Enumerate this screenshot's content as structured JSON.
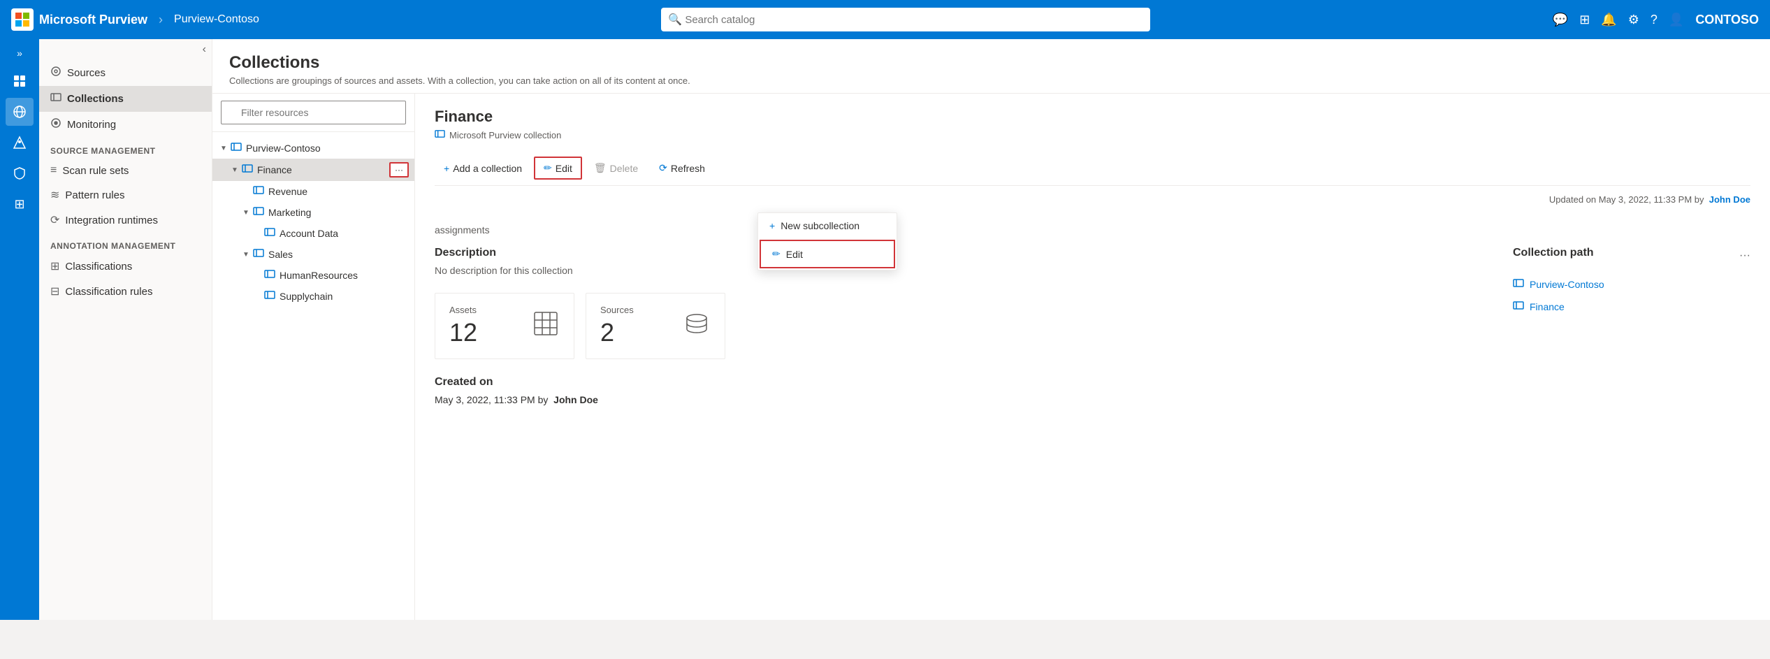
{
  "app": {
    "brand": "Microsoft Purview",
    "tenant": "Purview-Contoso",
    "search_placeholder": "Search catalog",
    "user": "CONTOSO"
  },
  "top_nav_icons": [
    {
      "name": "chat-icon",
      "symbol": "💬"
    },
    {
      "name": "grid-icon",
      "symbol": "⊞"
    },
    {
      "name": "bell-icon",
      "symbol": "🔔"
    },
    {
      "name": "settings-icon",
      "symbol": "⚙"
    },
    {
      "name": "help-icon",
      "symbol": "?"
    },
    {
      "name": "person-icon",
      "symbol": "👤"
    }
  ],
  "sidebar_icons": [
    {
      "name": "expand-icon",
      "symbol": "»"
    },
    {
      "name": "data-catalog-icon",
      "symbol": "🗂"
    },
    {
      "name": "data-map-icon",
      "symbol": "🗺"
    },
    {
      "name": "insights-icon",
      "symbol": "📊"
    },
    {
      "name": "policy-icon",
      "symbol": "🛡"
    },
    {
      "name": "solutions-icon",
      "symbol": "⊞"
    }
  ],
  "left_nav": {
    "collapse_label": "‹",
    "items": [
      {
        "id": "sources",
        "label": "Sources",
        "icon": "⊙"
      },
      {
        "id": "collections",
        "label": "Collections",
        "icon": "⊡",
        "active": true
      },
      {
        "id": "monitoring",
        "label": "Monitoring",
        "icon": "◎"
      }
    ],
    "source_management": {
      "label": "Source management",
      "items": [
        {
          "id": "scan-rule-sets",
          "label": "Scan rule sets",
          "icon": "≡"
        },
        {
          "id": "pattern-rules",
          "label": "Pattern rules",
          "icon": "≋"
        },
        {
          "id": "integration-runtimes",
          "label": "Integration runtimes",
          "icon": "⟳"
        }
      ]
    },
    "annotation_management": {
      "label": "Annotation management",
      "items": [
        {
          "id": "classifications",
          "label": "Classifications",
          "icon": "⊞"
        },
        {
          "id": "classification-rules",
          "label": "Classification rules",
          "icon": "⊟"
        }
      ]
    }
  },
  "page": {
    "title": "Collections",
    "description": "Collections are groupings of sources and assets. With a collection, you can take action on all of its content at once."
  },
  "filter": {
    "placeholder": "Filter resources"
  },
  "tree": {
    "root": "Purview-Contoso",
    "nodes": [
      {
        "id": "finance",
        "label": "Finance",
        "indent": 1,
        "selected": true,
        "show_more": true,
        "children": [
          {
            "id": "revenue",
            "label": "Revenue",
            "indent": 2
          },
          {
            "id": "marketing",
            "label": "Marketing",
            "indent": 2,
            "children": [
              {
                "id": "account-data",
                "label": "Account Data",
                "indent": 3
              }
            ]
          },
          {
            "id": "sales",
            "label": "Sales",
            "indent": 2,
            "children": [
              {
                "id": "human-resources",
                "label": "HumanResources",
                "indent": 3
              },
              {
                "id": "supplychain",
                "label": "Supplychain",
                "indent": 3
              }
            ]
          }
        ]
      }
    ]
  },
  "dropdown": {
    "items": [
      {
        "id": "new-subcollection",
        "label": "New subcollection",
        "icon": "+"
      },
      {
        "id": "edit",
        "label": "Edit",
        "icon": "✏",
        "highlighted": true
      }
    ]
  },
  "detail": {
    "title": "Finance",
    "subtitle": "Microsoft Purview collection",
    "subtitle_icon": "⊡",
    "updated": "Updated on May 3, 2022, 11:33 PM by",
    "updated_user": "John Doe",
    "toolbar": {
      "add_collection": "Add a collection",
      "add_icon": "+",
      "edit": "Edit",
      "edit_icon": "✏",
      "delete": "Delete",
      "delete_icon": "🗑",
      "refresh": "Refresh",
      "refresh_icon": "⟳"
    },
    "role_assignments_label": "assignments",
    "description_section": "Description",
    "no_description": "No description for this collection",
    "assets": {
      "label": "Assets",
      "value": "12",
      "icon": "⊞"
    },
    "sources": {
      "label": "Sources",
      "value": "2",
      "icon": "🗄"
    },
    "created_section": "Created on",
    "created_value": "May 3, 2022, 11:33 PM by",
    "created_user": "John Doe",
    "collection_path": {
      "title": "Collection path",
      "items": [
        {
          "id": "purview-contoso",
          "label": "Purview-Contoso",
          "icon": "⊡"
        },
        {
          "id": "finance",
          "label": "Finance",
          "icon": "⊡"
        }
      ]
    }
  }
}
